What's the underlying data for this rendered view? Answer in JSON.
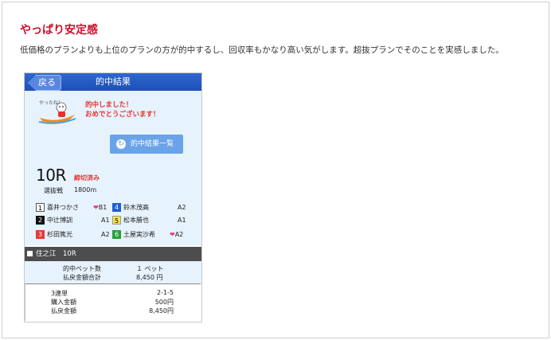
{
  "article": {
    "heading": "やっぱり安定感",
    "description": "低価格のプランよりも上位のプランの方が的中するし、回収率もかなり高い気がします。超抜プランでそのことを実感しました。"
  },
  "screen": {
    "back_label": "戻る",
    "title": "的中結果",
    "mascot_text": "やったね！",
    "congrats_line1": "的中しました！",
    "congrats_line2": "おめでとうございます！",
    "results_button": "的中結果一覧",
    "results_button_icon": "reload-icon"
  },
  "race": {
    "number": "10R",
    "status": "締切済み",
    "type": "選抜戦",
    "distance": "1800m"
  },
  "entrants": [
    {
      "boat": "1",
      "name": "喜井つかさ",
      "grade": "B1",
      "heart": true
    },
    {
      "boat": "2",
      "name": "中辻博訓",
      "grade": "A1",
      "heart": false
    },
    {
      "boat": "3",
      "name": "杉田篤光",
      "grade": "A2",
      "heart": false
    },
    {
      "boat": "4",
      "name": "鈴木茂高",
      "grade": "A2",
      "heart": false
    },
    {
      "boat": "5",
      "name": "松本勝也",
      "grade": "A1",
      "heart": false
    },
    {
      "boat": "6",
      "name": "土屋実沙希",
      "grade": "A2",
      "heart": true
    }
  ],
  "venue": {
    "label": "住之江　10R"
  },
  "summary": {
    "bets_label": "的中ベット数",
    "bets_value": "１ ベット",
    "payout_total_label": "払戻金額合計",
    "payout_total_value": "8,450 円"
  },
  "detail": {
    "bet_type": "3連単",
    "combination": "2-1-5",
    "purchase_label": "購入金額",
    "purchase_value": "500円",
    "payout_label": "払戻金額",
    "payout_value": "8,450円"
  },
  "colors": {
    "heading": "#c8102e",
    "topbar": "#1f4fb8",
    "panel_bg": "#e6f2fc",
    "button": "#6aa3e8",
    "alert_text": "#e8312c"
  }
}
